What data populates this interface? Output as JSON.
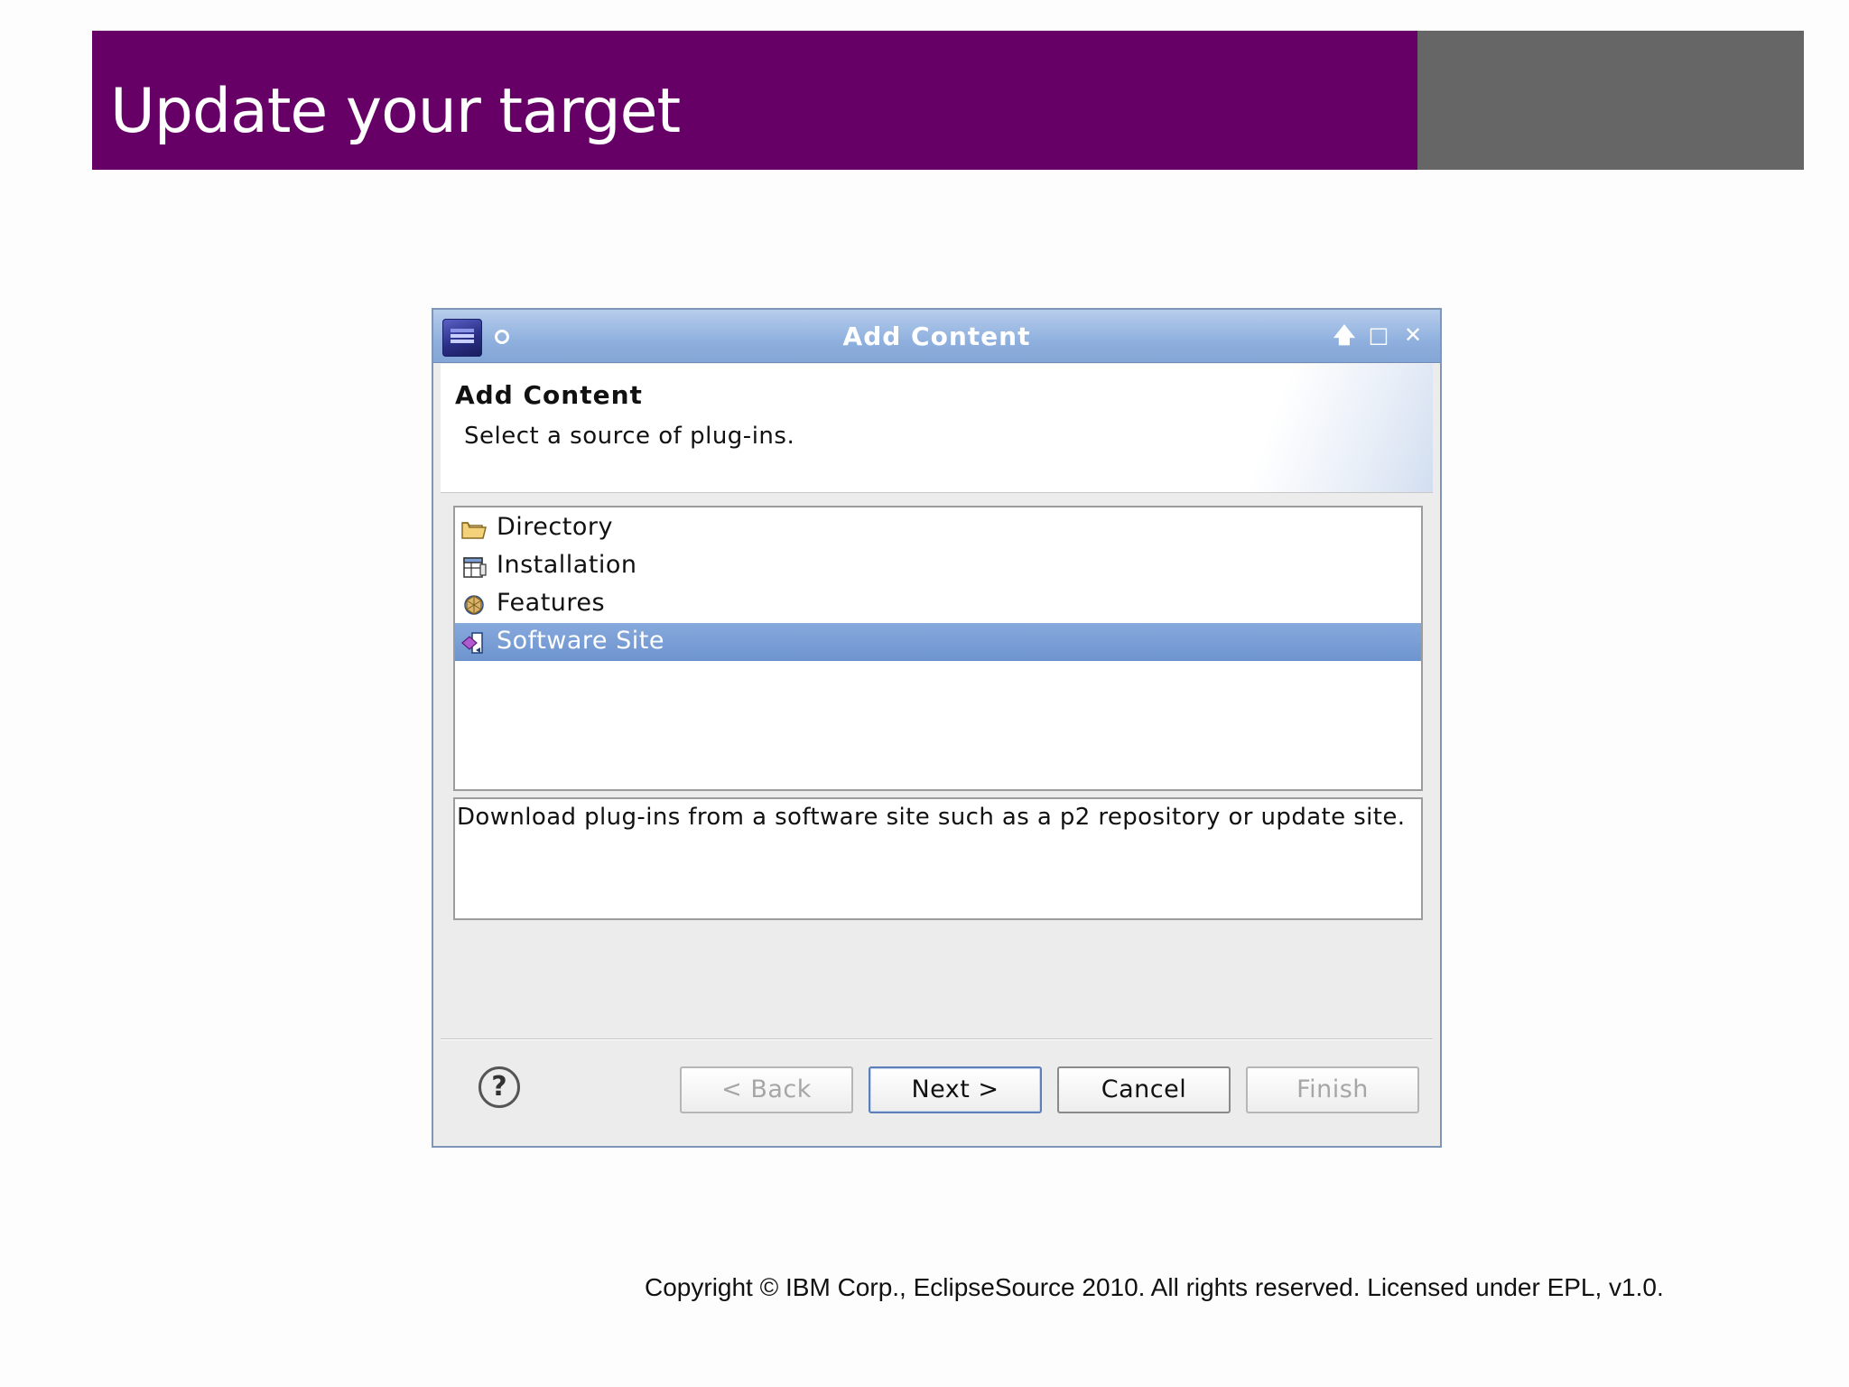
{
  "slide": {
    "title": "Update your target",
    "colors": {
      "header_purple": "#660066",
      "header_gray": "#666666"
    },
    "footer": "Copyright © IBM Corp., EclipseSource 2010. All rights reserved.  Licensed under EPL, v1.0."
  },
  "dialog": {
    "window_title": "Add Content",
    "controls": {
      "shade": "🡅",
      "maximize": "□",
      "close": "✕"
    },
    "banner": {
      "title": "Add Content",
      "description": "Select a source of plug-ins."
    },
    "sources": [
      {
        "label": "Directory",
        "icon": "folder-icon",
        "selected": false
      },
      {
        "label": "Installation",
        "icon": "installation-icon",
        "selected": false
      },
      {
        "label": "Features",
        "icon": "features-icon",
        "selected": false
      },
      {
        "label": "Software Site",
        "icon": "software-site-icon",
        "selected": true
      }
    ],
    "source_description": "Download plug-ins from a software site such as a p2 repository or update site.",
    "buttons": {
      "help": "?",
      "back": "< Back",
      "next": "Next >",
      "cancel": "Cancel",
      "finish": "Finish"
    },
    "colors": {
      "titlebar": "#8fb0de",
      "selection": "#7399d2"
    }
  }
}
